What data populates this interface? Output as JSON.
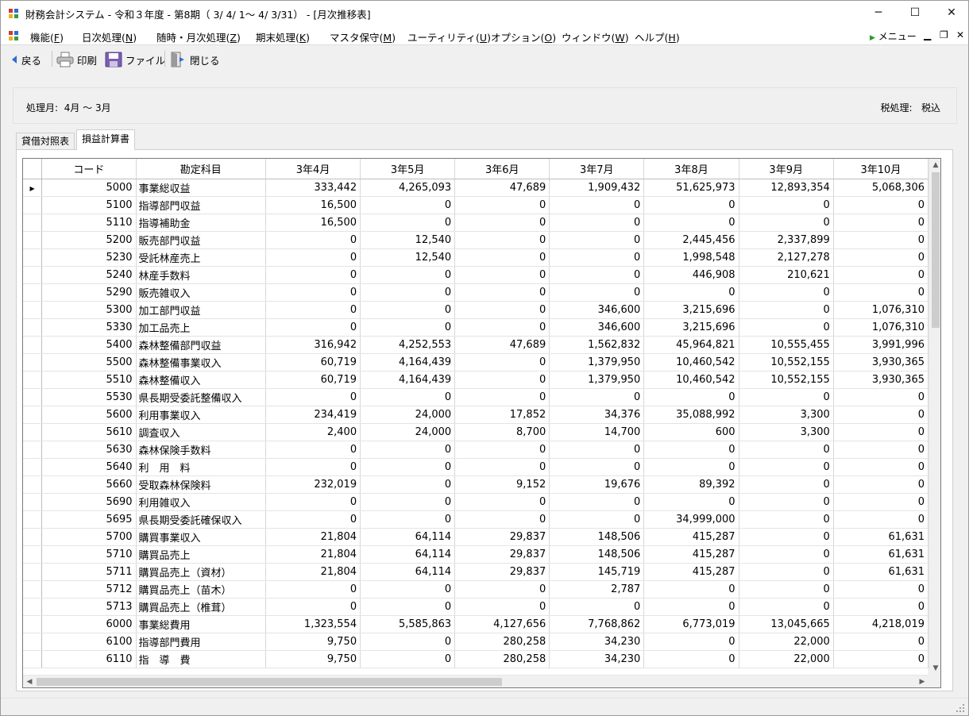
{
  "window": {
    "title": "財務会計システム - 令和３年度 - 第8期（ 3/ 4/ 1～ 4/ 3/31） - [月次推移表]",
    "minimize": "─",
    "maximize": "☐",
    "close": "✕"
  },
  "menu": {
    "items": [
      {
        "label": "機能",
        "key": "F"
      },
      {
        "label": "日次処理",
        "key": "N"
      },
      {
        "label": "随時・月次処理",
        "key": "Z"
      },
      {
        "label": "期末処理",
        "key": "K"
      },
      {
        "label": "マスタ保守",
        "key": "M"
      },
      {
        "label": "ユーティリティ",
        "key": "U"
      },
      {
        "label": "オプション",
        "key": "O"
      },
      {
        "label": "ウィンドウ",
        "key": "W"
      },
      {
        "label": "ヘルプ",
        "key": "H"
      }
    ],
    "menu_button": "メニュー",
    "mdi_min": "▁",
    "mdi_restore": "❐",
    "mdi_close": "✕"
  },
  "toolbar": {
    "back": "戻る",
    "print": "印刷",
    "file": "ファイル",
    "close": "閉じる"
  },
  "info": {
    "period_label": "処理月:",
    "period_value": "4月 ～ 3月",
    "tax_label": "税処理:",
    "tax_value": "税込"
  },
  "tabs": [
    "貸借対照表",
    "損益計算書"
  ],
  "active_tab": 1,
  "grid": {
    "columns": [
      "コード",
      "勘定科目",
      "3年4月",
      "3年5月",
      "3年6月",
      "3年7月",
      "3年8月",
      "3年9月",
      "3年10月"
    ],
    "current_row_marker": "▶",
    "rows": [
      [
        "5000",
        "事業総収益",
        "333,442",
        "4,265,093",
        "47,689",
        "1,909,432",
        "51,625,973",
        "12,893,354",
        "5,068,306"
      ],
      [
        "5100",
        "指導部門収益",
        "16,500",
        "0",
        "0",
        "0",
        "0",
        "0",
        "0"
      ],
      [
        "5110",
        "指導補助金",
        "16,500",
        "0",
        "0",
        "0",
        "0",
        "0",
        "0"
      ],
      [
        "5200",
        "販売部門収益",
        "0",
        "12,540",
        "0",
        "0",
        "2,445,456",
        "2,337,899",
        "0"
      ],
      [
        "5230",
        "受託林産売上",
        "0",
        "12,540",
        "0",
        "0",
        "1,998,548",
        "2,127,278",
        "0"
      ],
      [
        "5240",
        "林産手数料",
        "0",
        "0",
        "0",
        "0",
        "446,908",
        "210,621",
        "0"
      ],
      [
        "5290",
        "販売雑収入",
        "0",
        "0",
        "0",
        "0",
        "0",
        "0",
        "0"
      ],
      [
        "5300",
        "加工部門収益",
        "0",
        "0",
        "0",
        "346,600",
        "3,215,696",
        "0",
        "1,076,310"
      ],
      [
        "5330",
        "加工品売上",
        "0",
        "0",
        "0",
        "346,600",
        "3,215,696",
        "0",
        "1,076,310"
      ],
      [
        "5400",
        "森林整備部門収益",
        "316,942",
        "4,252,553",
        "47,689",
        "1,562,832",
        "45,964,821",
        "10,555,455",
        "3,991,996"
      ],
      [
        "5500",
        "森林整備事業収入",
        "60,719",
        "4,164,439",
        "0",
        "1,379,950",
        "10,460,542",
        "10,552,155",
        "3,930,365"
      ],
      [
        "5510",
        "森林整備収入",
        "60,719",
        "4,164,439",
        "0",
        "1,379,950",
        "10,460,542",
        "10,552,155",
        "3,930,365"
      ],
      [
        "5530",
        "県長期受委託整備収入",
        "0",
        "0",
        "0",
        "0",
        "0",
        "0",
        "0"
      ],
      [
        "5600",
        "利用事業収入",
        "234,419",
        "24,000",
        "17,852",
        "34,376",
        "35,088,992",
        "3,300",
        "0"
      ],
      [
        "5610",
        "調査収入",
        "2,400",
        "24,000",
        "8,700",
        "14,700",
        "600",
        "3,300",
        "0"
      ],
      [
        "5630",
        "森林保険手数料",
        "0",
        "0",
        "0",
        "0",
        "0",
        "0",
        "0"
      ],
      [
        "5640",
        "利　用　料",
        "0",
        "0",
        "0",
        "0",
        "0",
        "0",
        "0"
      ],
      [
        "5660",
        "受取森林保険料",
        "232,019",
        "0",
        "9,152",
        "19,676",
        "89,392",
        "0",
        "0"
      ],
      [
        "5690",
        "利用雑収入",
        "0",
        "0",
        "0",
        "0",
        "0",
        "0",
        "0"
      ],
      [
        "5695",
        "県長期受委託確保収入",
        "0",
        "0",
        "0",
        "0",
        "34,999,000",
        "0",
        "0"
      ],
      [
        "5700",
        "購買事業収入",
        "21,804",
        "64,114",
        "29,837",
        "148,506",
        "415,287",
        "0",
        "61,631"
      ],
      [
        "5710",
        "購買品売上",
        "21,804",
        "64,114",
        "29,837",
        "148,506",
        "415,287",
        "0",
        "61,631"
      ],
      [
        "5711",
        "購買品売上（資材）",
        "21,804",
        "64,114",
        "29,837",
        "145,719",
        "415,287",
        "0",
        "61,631"
      ],
      [
        "5712",
        "購買品売上（苗木）",
        "0",
        "0",
        "0",
        "2,787",
        "0",
        "0",
        "0"
      ],
      [
        "5713",
        "購買品売上（椎茸）",
        "0",
        "0",
        "0",
        "0",
        "0",
        "0",
        "0"
      ],
      [
        "6000",
        "事業総費用",
        "1,323,554",
        "5,585,863",
        "4,127,656",
        "7,768,862",
        "6,773,019",
        "13,045,665",
        "4,218,019"
      ],
      [
        "6100",
        "指導部門費用",
        "9,750",
        "0",
        "280,258",
        "34,230",
        "0",
        "22,000",
        "0"
      ],
      [
        "6110",
        "指　導　費",
        "9,750",
        "0",
        "280,258",
        "34,230",
        "0",
        "22,000",
        "0"
      ]
    ]
  }
}
